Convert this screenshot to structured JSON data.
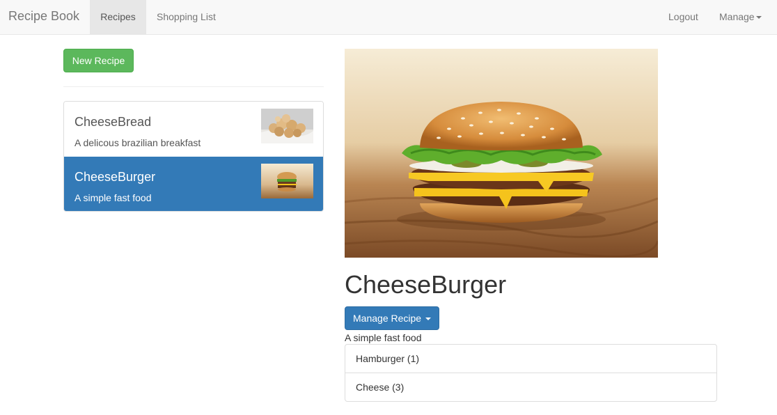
{
  "navbar": {
    "brand": "Recipe Book",
    "links": [
      "Recipes",
      "Shopping List"
    ],
    "right": {
      "logout": "Logout",
      "manage": "Manage"
    }
  },
  "sidebar": {
    "new_recipe": "New Recipe",
    "recipes": [
      {
        "name": "CheeseBread",
        "description": "A delicous brazilian breakfast"
      },
      {
        "name": "CheeseBurger",
        "description": "A simple fast food"
      }
    ]
  },
  "detail": {
    "title": "CheeseBurger",
    "manage_button": "Manage Recipe",
    "description": "A simple fast food",
    "ingredients": [
      "Hamburger (1)",
      "Cheese (3)"
    ]
  },
  "colors": {
    "primary": "#337ab7",
    "success": "#5cb85c",
    "navbar_bg": "#f8f8f8"
  },
  "icons": {
    "dropdown": "caret-down-icon"
  }
}
